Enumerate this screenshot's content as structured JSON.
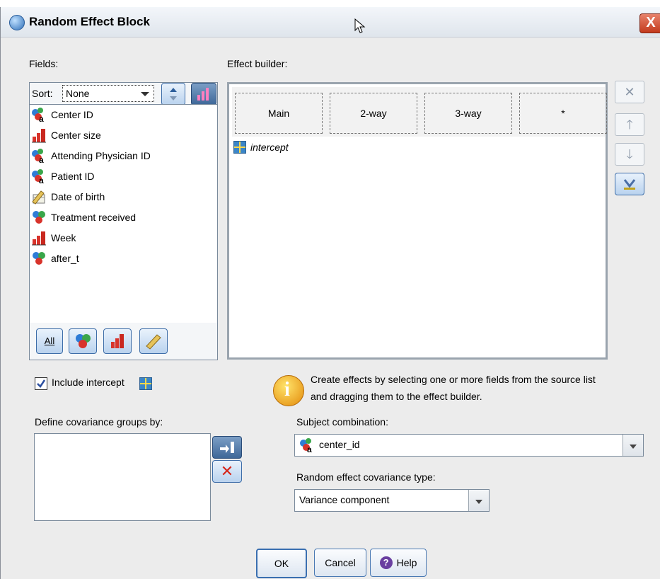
{
  "window": {
    "title": "Random Effect Block",
    "close": "X"
  },
  "fields": {
    "label": "Fields:",
    "sort_label": "Sort:",
    "sort_value": "None",
    "items": [
      {
        "label": "Center ID",
        "icon": "nominal-string-icon"
      },
      {
        "label": "Center size",
        "icon": "ordinal-icon"
      },
      {
        "label": "Attending Physician ID",
        "icon": "nominal-string-icon"
      },
      {
        "label": "Patient ID",
        "icon": "nominal-string-icon"
      },
      {
        "label": "Date of birth",
        "icon": "date-scale-icon"
      },
      {
        "label": "Treatment received",
        "icon": "nominal-icon"
      },
      {
        "label": "Week",
        "icon": "ordinal-icon"
      },
      {
        "label": "after_t",
        "icon": "nominal-icon"
      }
    ],
    "filter_all_label": "All"
  },
  "effect_builder": {
    "label": "Effect builder:",
    "columns": [
      "Main",
      "2-way",
      "3-way",
      "*"
    ],
    "items": [
      "intercept"
    ]
  },
  "include_intercept": {
    "label": "Include intercept",
    "checked": true
  },
  "info": {
    "line1": "Create effects by selecting one or more fields from the source list",
    "line2": "and dragging them to the effect builder."
  },
  "covariance_groups": {
    "label": "Define covariance groups by:"
  },
  "subject_combination": {
    "label": "Subject combination:",
    "value": "center_id"
  },
  "covariance_type": {
    "label": "Random effect covariance type:",
    "value": "Variance component"
  },
  "buttons": {
    "ok": "OK",
    "cancel": "Cancel",
    "help": "Help"
  }
}
